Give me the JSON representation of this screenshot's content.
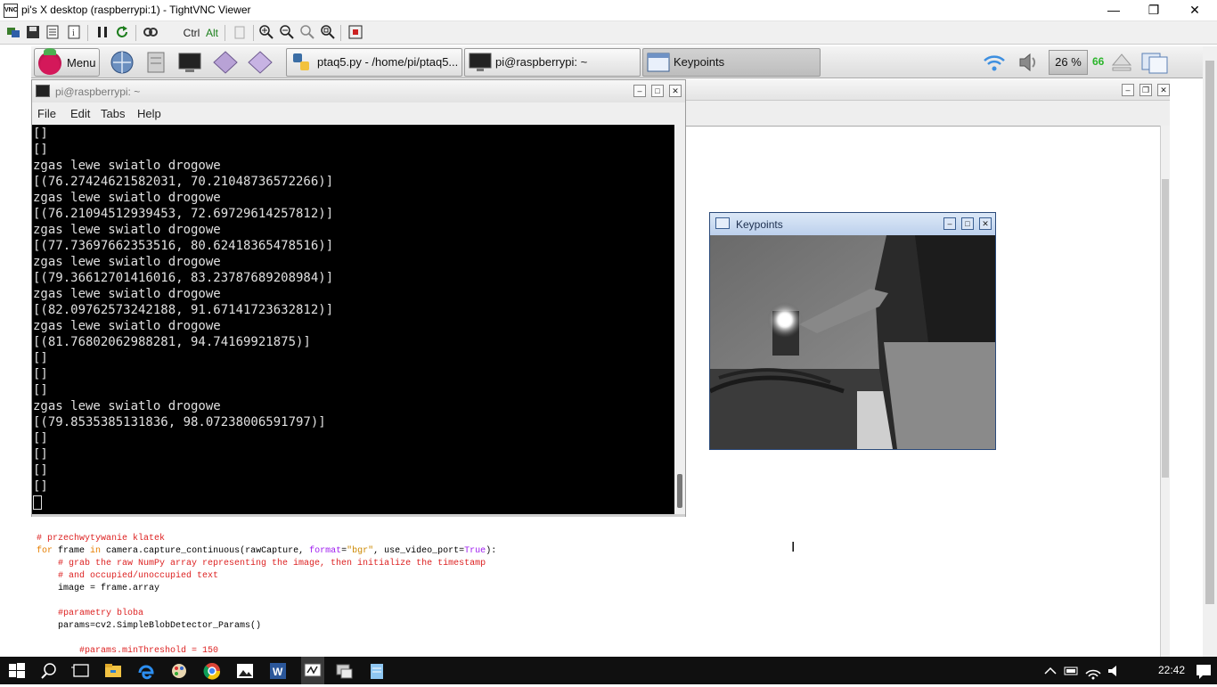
{
  "vnc": {
    "title": "pi's X desktop (raspberrypi:1) - TightVNC Viewer",
    "icon_label": "VNC",
    "ctrl_label": "Ctrl",
    "alt_label": "Alt",
    "minimize": "—",
    "maximize": "❐",
    "close": "✕"
  },
  "panel": {
    "menu_label": "Menu",
    "tasks": [
      {
        "label": "ptaq5.py - /home/pi/ptaq5..."
      },
      {
        "label": "pi@raspberrypi: ~"
      },
      {
        "label": "Keypoints"
      }
    ],
    "cpu_label": "26 %",
    "cpu_temp": "66"
  },
  "terminal": {
    "title": "pi@raspberrypi: ~",
    "menu": [
      "File",
      "Edit",
      "Tabs",
      "Help"
    ],
    "lines": [
      "[]",
      "[]",
      "zgas lewe swiatlo drogowe",
      "[(76.27424621582031, 70.21048736572266)]",
      "zgas lewe swiatlo drogowe",
      "[(76.21094512939453, 72.69729614257812)]",
      "zgas lewe swiatlo drogowe",
      "[(77.73697662353516, 80.62418365478516)]",
      "zgas lewe swiatlo drogowe",
      "[(79.36612701416016, 83.23787689208984)]",
      "zgas lewe swiatlo drogowe",
      "[(82.09762573242188, 91.67141723632812)]",
      "zgas lewe swiatlo drogowe",
      "[(81.76802062988281, 94.74169921875)]",
      "[]",
      "[]",
      "[]",
      "zgas lewe swiatlo drogowe",
      "[(79.8535385131836, 98.07238006591797)]",
      "[]",
      "[]",
      "[]",
      "[]"
    ]
  },
  "keypoints": {
    "title": "Keypoints"
  },
  "code": {
    "l1": "# przechwytywanie klatek",
    "l2_kw1": "for",
    "l2_a": " frame ",
    "l2_kw2": "in",
    "l2_b": " camera.capture_continuous(rawCapture, ",
    "l2_kw3": "format",
    "l2_c": "=",
    "l2_str": "\"bgr\"",
    "l2_d": ", use_video_port=",
    "l2_true": "True",
    "l2_e": "):",
    "l3": "    # grab the raw NumPy array representing the image, then initialize the timestamp",
    "l4": "    # and occupied/unoccupied text",
    "l5": "    image = frame.array",
    "l6": "",
    "l7": "    #parametry bloba",
    "l8": "    params=cv2.SimpleBlobDetector_Params()",
    "l9": "",
    "l10": "        #params.minThreshold = 150"
  },
  "taskbar": {
    "time": "22:42"
  }
}
